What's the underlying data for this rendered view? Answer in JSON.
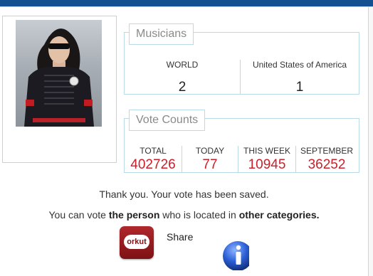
{
  "musicians": {
    "legend": "Musicians",
    "columns": [
      {
        "label": "WORLD",
        "value": "2"
      },
      {
        "label": "United States of America",
        "value": "1"
      }
    ]
  },
  "votes": {
    "legend": "Vote Counts",
    "columns": [
      {
        "label": "TOTAL",
        "value": "402726"
      },
      {
        "label": "TODAY",
        "value": "77"
      },
      {
        "label": "THIS WEEK",
        "value": "10945"
      },
      {
        "label": "SEPTEMBER",
        "value": "36252"
      }
    ]
  },
  "messages": {
    "thanks": "Thank you. Your vote has been saved.",
    "vote_prefix": "You can vote ",
    "vote_bold1": "the person",
    "vote_mid": " who is located in ",
    "vote_bold2": "other categories."
  },
  "share": {
    "orkut_label": "orkut",
    "share_label": "Share"
  },
  "icons": {
    "orkut": "orkut-icon",
    "info": "info-icon"
  },
  "colors": {
    "topbar": "#13508f",
    "panel_border": "#b8dbe7",
    "vote_value": "#c9202c"
  }
}
